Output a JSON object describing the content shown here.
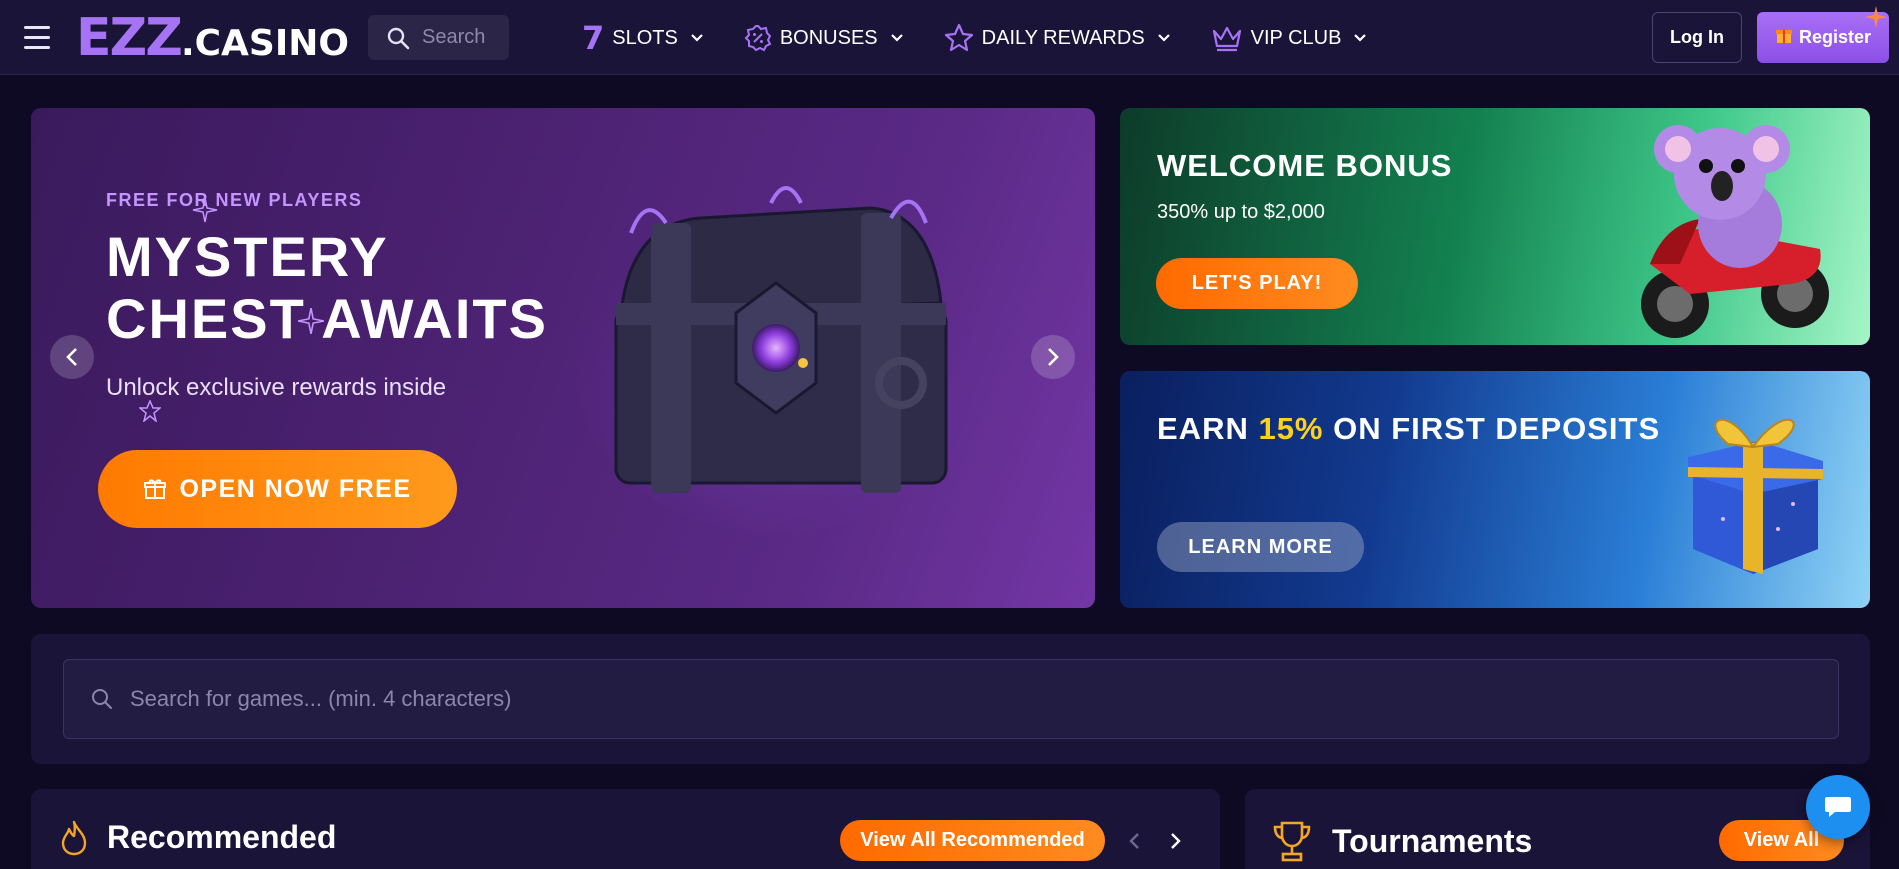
{
  "header": {
    "logo_main": "EZZ",
    "logo_suffix": ".CASINO",
    "search_placeholder": "Search",
    "nav": [
      {
        "label": "SLOTS",
        "icon": "seven-icon"
      },
      {
        "label": "BONUSES",
        "icon": "bonus-badge-icon"
      },
      {
        "label": "DAILY REWARDS",
        "icon": "star-icon"
      },
      {
        "label": "VIP CLUB",
        "icon": "crown-icon"
      }
    ],
    "login_label": "Log In",
    "register_label": "Register"
  },
  "hero": {
    "kicker": "FREE FOR NEW PLAYERS",
    "headline_line1": "MYSTERY",
    "headline_line2": "CHEST AWAITS",
    "subtitle": "Unlock exclusive rewards inside",
    "cta_label": "OPEN NOW FREE"
  },
  "promos": {
    "welcome": {
      "title": "WELCOME BONUS",
      "text": "350% up to $2,000",
      "button": "LET'S PLAY!"
    },
    "deposit": {
      "title_prefix": "EARN ",
      "title_highlight": "15%",
      "title_suffix": " ON FIRST DEPOSITS",
      "button": "LEARN MORE"
    }
  },
  "games_search": {
    "placeholder": "Search for games... (min. 4 characters)"
  },
  "sections": {
    "recommended": {
      "title": "Recommended",
      "view_all": "View All Recommended"
    },
    "tournaments": {
      "title": "Tournaments",
      "view_all": "View All"
    }
  },
  "colors": {
    "page_bg": "#0e0a24",
    "header_bg": "#1a1438",
    "accent_purple": "#a773f5",
    "accent_orange": "#ff7a00",
    "highlight_yellow": "#ffd21a",
    "chat_blue": "#1d8ff0"
  }
}
